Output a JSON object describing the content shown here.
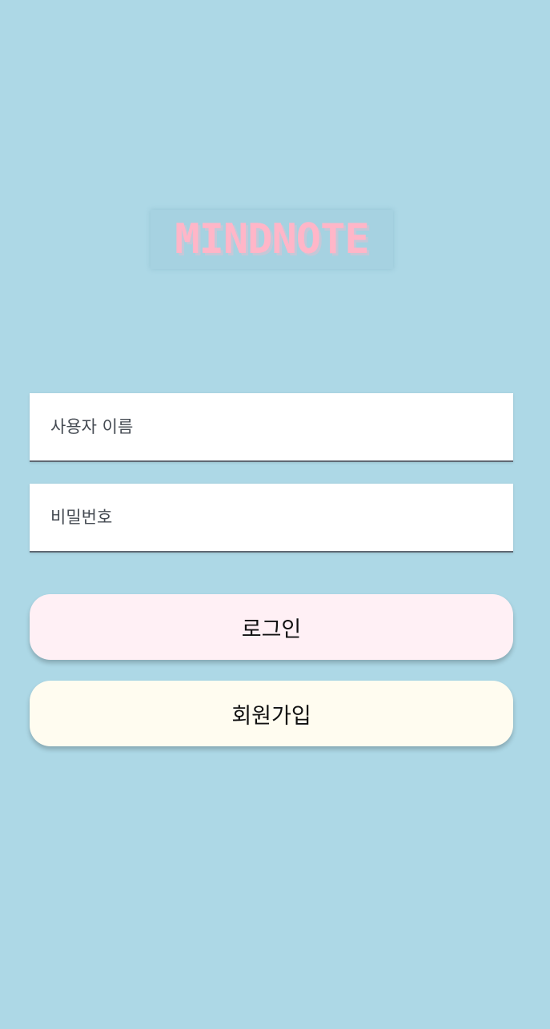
{
  "app": {
    "logo_text": "MINDNOTE"
  },
  "form": {
    "username_placeholder": "사용자 이름",
    "password_placeholder": "비밀번호",
    "login_label": "로그인",
    "signup_label": "회원가입"
  },
  "colors": {
    "background": "#add8e6",
    "logo": "#ffb6c8",
    "login_button": "#fff0f5",
    "signup_button": "#fffcf0",
    "field_underline": "#5f6873"
  }
}
